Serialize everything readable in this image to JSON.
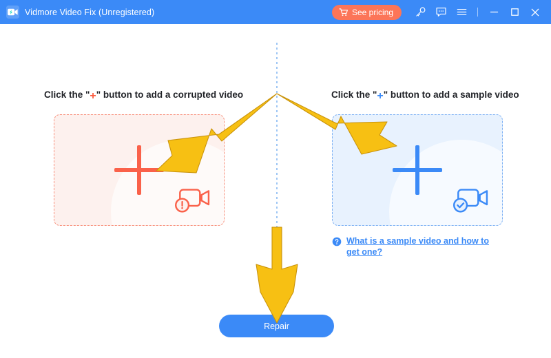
{
  "window": {
    "title": "Vidmore Video Fix (Unregistered)",
    "logo_icon": "video-camera-bolt-logo",
    "accent_blue": "#3b8af7",
    "accent_red": "#fa614a",
    "accent_orange": "#fc7558",
    "arrow_color": "#f7c013"
  },
  "titlebar": {
    "pricing_label": "See pricing",
    "cart_icon": "shopping-cart-icon",
    "key_icon": "key-icon",
    "feedback_icon": "feedback-icon",
    "menu_icon": "hamburger-menu-icon",
    "minimize_icon": "minimize-icon",
    "maximize_icon": "maximize-icon",
    "close_icon": "close-icon"
  },
  "left_panel": {
    "heading_before": "Click the \"",
    "heading_plus": "+",
    "heading_after": "\" button to add a corrupted video",
    "dropzone_name": "corrupted-video-dropzone",
    "plus_icon": "plus-icon",
    "status_icon": "video-error-icon"
  },
  "right_panel": {
    "heading_before": "Click the \"",
    "heading_plus": "+",
    "heading_after": "\" button to add a sample video",
    "dropzone_name": "sample-video-dropzone",
    "plus_icon": "plus-icon",
    "status_icon": "video-ok-icon",
    "help_icon": "question-circle-icon",
    "help_link": "What is a sample video and how to get one?"
  },
  "actions": {
    "repair_label": "Repair"
  },
  "annotations": {
    "arrow_left": "arrow-pointing-to-corrupted-dropzone",
    "arrow_right": "arrow-pointing-to-sample-dropzone",
    "arrow_down": "arrow-pointing-to-repair-button",
    "divider": "vertical-dotted-divider"
  }
}
